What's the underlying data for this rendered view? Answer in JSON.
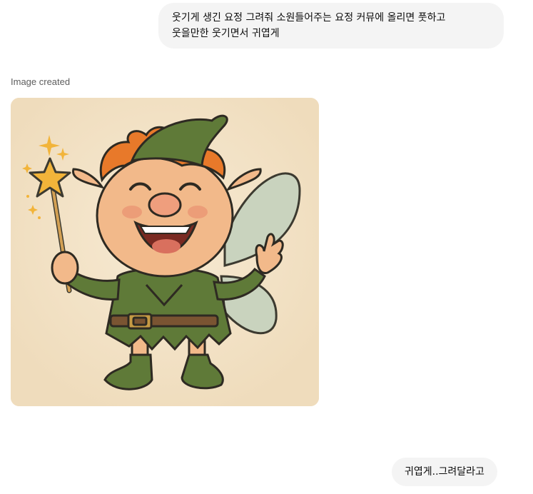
{
  "conversation": {
    "user_message_1": {
      "lines": [
        "웃기게 생긴 요정 그려줘 소원들어주는 요정 커뮤에 올리면 풋하고",
        "웃을만한 웃기면서 귀엽게"
      ]
    },
    "assistant_message": {
      "status": "Image created",
      "image": {
        "subject": "laughing-fairy-illustration",
        "colors": {
          "background": "#f3e3c9",
          "skin": "#f2b98a",
          "hair": "#e8792a",
          "clothing": "#5f7a38",
          "wings": "#c9d3be",
          "star": "#f2b43a",
          "outline": "#2e2a22"
        }
      }
    },
    "user_message_2": {
      "text": "귀엽게..그려달라고"
    }
  }
}
